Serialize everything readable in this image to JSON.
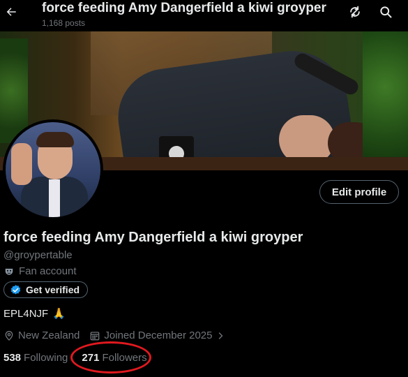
{
  "header": {
    "title": "force feeding Amy Dangerfield a kiwi groyper",
    "post_count": "1,168 posts"
  },
  "profile": {
    "display_name": "force feeding Amy Dangerfield a kiwi groyper",
    "handle": "@groypertable",
    "category": "Fan account",
    "verify_label": "Get verified",
    "bio_text": "EPL4NJF",
    "bio_emoji": "🙏",
    "location": "New Zealand",
    "joined": "Joined December 2025",
    "following_count": "538",
    "following_label": "Following",
    "followers_count": "271",
    "followers_label": "Followers",
    "edit_label": "Edit profile"
  },
  "colors": {
    "background": "#000000",
    "text_primary": "#e7e9ea",
    "text_secondary": "#71767b",
    "border": "#536471",
    "verified_blue": "#1d9bf0",
    "annotation_red": "#e0191f"
  },
  "icons": [
    "back-arrow-icon",
    "refresh-icon",
    "search-icon",
    "mask-icon",
    "verified-badge-icon",
    "location-pin-icon",
    "calendar-icon",
    "chevron-right-icon"
  ]
}
